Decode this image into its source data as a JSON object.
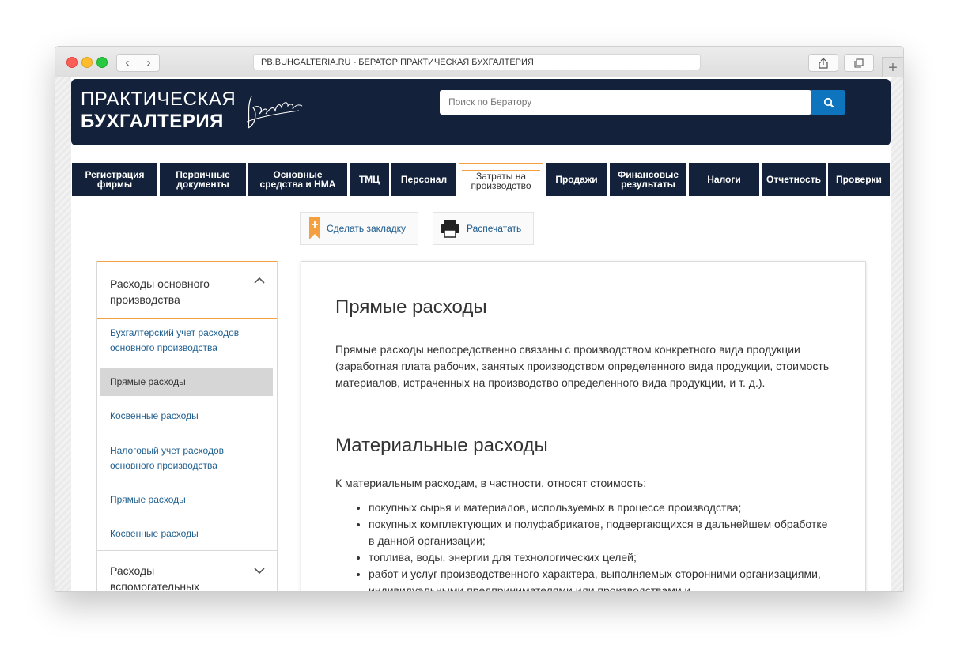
{
  "browser": {
    "address": "PB.BUHGALTERIA.RU  -  БЕРАТОР ПРАКТИЧЕСКАЯ БУХГАЛТЕРИЯ"
  },
  "header": {
    "logo_line1": "ПРАКТИЧЕСКАЯ",
    "logo_line2": "БУХГАЛТЕРИЯ",
    "search_placeholder": "Поиск по Бератору"
  },
  "tabs": [
    {
      "label": "Регистрация фирмы"
    },
    {
      "label": "Первичные документы"
    },
    {
      "label": "Основные средства и НМА"
    },
    {
      "label": "ТМЦ"
    },
    {
      "label": "Персонал"
    },
    {
      "label": "Затраты на производство"
    },
    {
      "label": "Продажи"
    },
    {
      "label": "Финансовые результаты"
    },
    {
      "label": "Налоги"
    },
    {
      "label": "Отчетность"
    },
    {
      "label": "Проверки"
    }
  ],
  "actions": {
    "bookmark": "Сделать закладку",
    "print": "Распечатать"
  },
  "sidebar": {
    "section1_title": "Расходы основного производства",
    "items": [
      {
        "label": "Бухгалтерский учет расходов основного производства"
      },
      {
        "label": "Прямые расходы"
      },
      {
        "label": "Косвенные расходы"
      },
      {
        "label": "Налоговый учет расходов основного производства"
      },
      {
        "label": "Прямые расходы"
      },
      {
        "label": "Косвенные расходы"
      }
    ],
    "section2_title": "Расходы вспомогательных"
  },
  "article": {
    "title": "Прямые расходы",
    "paragraph1": "Прямые расходы непосредственно связаны с производством конкретного вида продукции (заработная плата рабочих, занятых производством определенного вида продукции, стоимость материалов, истраченных на производство определенного вида продукции, и т. д.).",
    "subtitle": "Материальные расходы",
    "paragraph2": "К материальным расходам, в частности, относят стоимость:",
    "bullets": [
      "покупных сырья и материалов, используемых в процессе производства;",
      "покупных комплектующих и полуфабрикатов, подвергающихся в дальнейшем обработке в данной организации;",
      "топлива, воды, энергии для технологических целей;",
      "работ и услуг производственного характера, выполняемых сторонними организациями, индивидуальными предпринимателями или производствами и"
    ]
  },
  "colors": {
    "header_bg": "#13223a",
    "accent_orange": "#f5a040",
    "search_button": "#0e74bd",
    "link": "#1f5f8f"
  }
}
